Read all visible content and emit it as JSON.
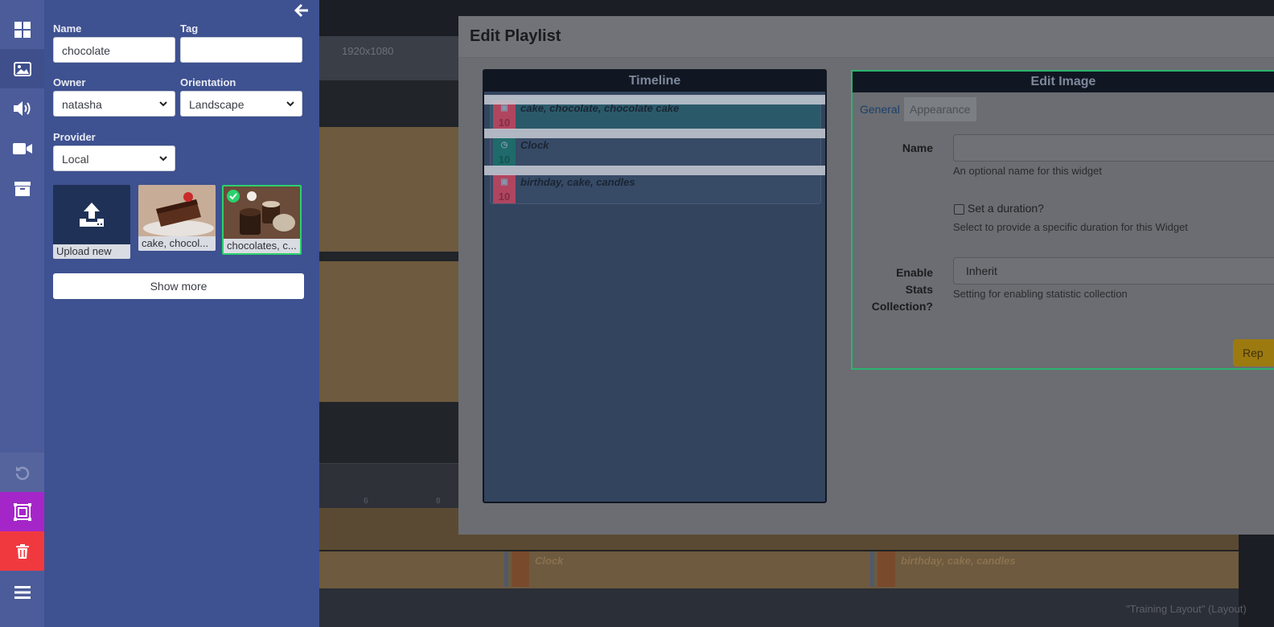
{
  "background": {
    "resolution_text": "1920x1080",
    "ruler_ticks": [
      "6",
      "8"
    ],
    "track_items": [
      "Clock",
      "birthday, cake, candles"
    ],
    "footer_text": "\"Training Layout\" (Layout)"
  },
  "modal": {
    "title": "Edit Playlist",
    "timeline": {
      "header": "Timeline",
      "items": [
        {
          "label": "cake, chocolate, chocolate cake",
          "duration": "10",
          "icon": "image-icon"
        },
        {
          "label": "Clock",
          "duration": "10",
          "icon": "clock-icon"
        },
        {
          "label": "birthday, cake, candles",
          "duration": "10",
          "icon": "image-icon"
        }
      ]
    },
    "edit": {
      "header": "Edit Image",
      "tabs": [
        "General",
        "Appearance"
      ],
      "name_label": "Name",
      "name_value": "",
      "name_help": "An optional name for this widget",
      "duration_label": "Set a duration?",
      "duration_help": "Select to provide a specific duration for this Widget",
      "stats_label": "Enable Stats Collection?",
      "stats_value": "Inherit",
      "stats_help": "Setting for enabling statistic collection",
      "replace_label": "Rep"
    }
  },
  "toolbox": {
    "name_label": "Name",
    "name_value": "chocolate",
    "tag_label": "Tag",
    "tag_value": "",
    "owner_label": "Owner",
    "owner_value": "natasha",
    "orientation_label": "Orientation",
    "orientation_value": "Landscape",
    "provider_label": "Provider",
    "provider_value": "Local",
    "cards": [
      {
        "caption": "Upload new"
      },
      {
        "caption": "cake, chocol..."
      },
      {
        "caption": "chocolates, c..."
      }
    ],
    "show_more": "Show more"
  },
  "colors": {
    "rail": "#4c5c9a",
    "toolbox": "#3e5190",
    "selected_border": "#2bd16c",
    "purple_button": "#a526c8",
    "red_button": "#f0393f"
  }
}
